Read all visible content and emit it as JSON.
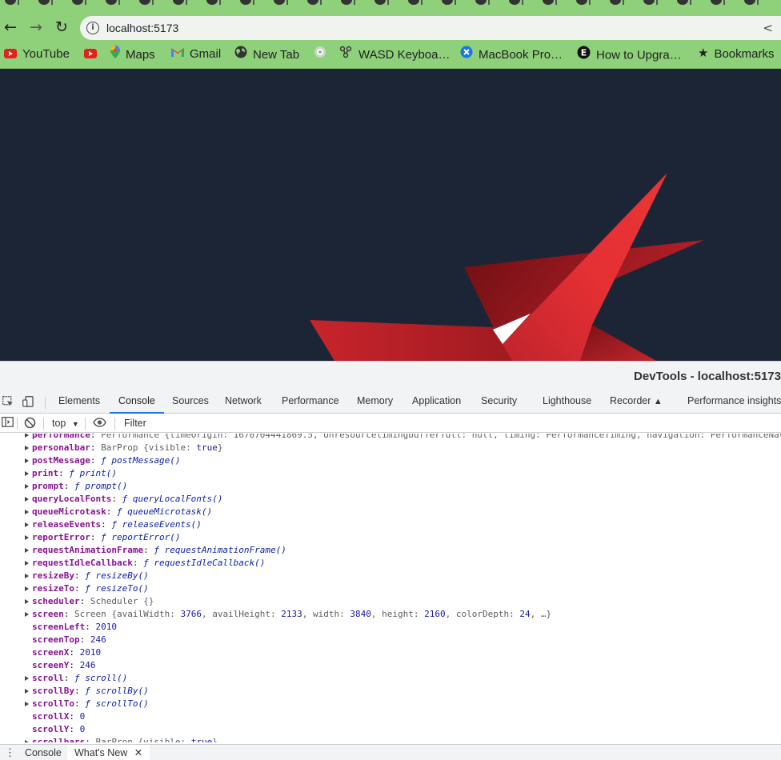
{
  "browser": {
    "url": "localhost:5173",
    "bookmarks": [
      {
        "label": "YouTube",
        "icon": "youtube-icon"
      },
      {
        "label": "",
        "icon": "youtube-icon"
      },
      {
        "label": "Maps",
        "icon": "maps-pin-icon"
      },
      {
        "label": "Gmail",
        "icon": "gmail-icon"
      },
      {
        "label": "New Tab",
        "icon": "globe-icon"
      },
      {
        "label": "",
        "icon": "app-icon"
      },
      {
        "label": "WASD Keyboa…",
        "icon": "keyboard-icon"
      },
      {
        "label": "MacBook Pro…",
        "icon": "x-circle-icon"
      },
      {
        "label": "How to Upgra…",
        "icon": "e-circle-icon"
      },
      {
        "label": "Bookmarks",
        "icon": "star-icon"
      }
    ],
    "colors": {
      "chrome": "#8fd07a",
      "page_bg": "#1c2536",
      "shape_red": "#e03030",
      "shape_dark_red": "#8b1a1a"
    }
  },
  "devtools": {
    "title": "DevTools - localhost:5173",
    "tabs": [
      "Elements",
      "Console",
      "Sources",
      "Network",
      "Performance",
      "Memory",
      "Application",
      "Security",
      "Lighthouse",
      "Recorder",
      "Performance insights"
    ],
    "active_tab": "Console",
    "context": "top",
    "filter_placeholder": "Filter",
    "drawer_tabs": [
      "Console",
      "What's New"
    ],
    "console_rows": [
      {
        "expand": true,
        "key": "performance",
        "sep": ": ",
        "parts": [
          [
            "g",
            "Performance {timeOrigin: 1670704441869.5, onresourcetimingbufferfull: null, timing: PerformanceTiming, navigation: PerformanceNav"
          ]
        ]
      },
      {
        "expand": true,
        "key": "personalbar",
        "sep": ": ",
        "parts": [
          [
            "g",
            "BarProp {visible: "
          ],
          [
            "n",
            "true"
          ],
          [
            "g",
            "}"
          ]
        ]
      },
      {
        "expand": true,
        "key": "postMessage",
        "sep": ": ",
        "parts": [
          [
            "f",
            "ƒ postMessage()"
          ]
        ]
      },
      {
        "expand": true,
        "key": "print",
        "sep": ": ",
        "parts": [
          [
            "f",
            "ƒ print()"
          ]
        ]
      },
      {
        "expand": true,
        "key": "prompt",
        "sep": ": ",
        "parts": [
          [
            "f",
            "ƒ prompt()"
          ]
        ]
      },
      {
        "expand": true,
        "key": "queryLocalFonts",
        "sep": ": ",
        "parts": [
          [
            "f",
            "ƒ queryLocalFonts()"
          ]
        ]
      },
      {
        "expand": true,
        "key": "queueMicrotask",
        "sep": ": ",
        "parts": [
          [
            "f",
            "ƒ queueMicrotask()"
          ]
        ]
      },
      {
        "expand": true,
        "key": "releaseEvents",
        "sep": ": ",
        "parts": [
          [
            "f",
            "ƒ releaseEvents()"
          ]
        ]
      },
      {
        "expand": true,
        "key": "reportError",
        "sep": ": ",
        "parts": [
          [
            "f",
            "ƒ reportError()"
          ]
        ]
      },
      {
        "expand": true,
        "key": "requestAnimationFrame",
        "sep": ": ",
        "parts": [
          [
            "f",
            "ƒ requestAnimationFrame()"
          ]
        ]
      },
      {
        "expand": true,
        "key": "requestIdleCallback",
        "sep": ": ",
        "parts": [
          [
            "f",
            "ƒ requestIdleCallback()"
          ]
        ]
      },
      {
        "expand": true,
        "key": "resizeBy",
        "sep": ": ",
        "parts": [
          [
            "f",
            "ƒ resizeBy()"
          ]
        ]
      },
      {
        "expand": true,
        "key": "resizeTo",
        "sep": ": ",
        "parts": [
          [
            "f",
            "ƒ resizeTo()"
          ]
        ]
      },
      {
        "expand": true,
        "key": "scheduler",
        "sep": ": ",
        "parts": [
          [
            "g",
            "Scheduler {}"
          ]
        ]
      },
      {
        "expand": true,
        "key": "screen",
        "sep": ": ",
        "parts": [
          [
            "g",
            "Screen {availWidth: "
          ],
          [
            "n",
            "3766"
          ],
          [
            "g",
            ", availHeight: "
          ],
          [
            "n",
            "2133"
          ],
          [
            "g",
            ", width: "
          ],
          [
            "n",
            "3840"
          ],
          [
            "g",
            ", height: "
          ],
          [
            "n",
            "2160"
          ],
          [
            "g",
            ", colorDepth: "
          ],
          [
            "n",
            "24"
          ],
          [
            "g",
            ", …}"
          ]
        ]
      },
      {
        "expand": false,
        "key": "screenLeft",
        "sep": ": ",
        "parts": [
          [
            "n",
            "2010"
          ]
        ]
      },
      {
        "expand": false,
        "key": "screenTop",
        "sep": ": ",
        "parts": [
          [
            "n",
            "246"
          ]
        ]
      },
      {
        "expand": false,
        "key": "screenX",
        "sep": ": ",
        "parts": [
          [
            "n",
            "2010"
          ]
        ]
      },
      {
        "expand": false,
        "key": "screenY",
        "sep": ": ",
        "parts": [
          [
            "n",
            "246"
          ]
        ]
      },
      {
        "expand": true,
        "key": "scroll",
        "sep": ": ",
        "parts": [
          [
            "f",
            "ƒ scroll()"
          ]
        ]
      },
      {
        "expand": true,
        "key": "scrollBy",
        "sep": ": ",
        "parts": [
          [
            "f",
            "ƒ scrollBy()"
          ]
        ]
      },
      {
        "expand": true,
        "key": "scrollTo",
        "sep": ": ",
        "parts": [
          [
            "f",
            "ƒ scrollTo()"
          ]
        ]
      },
      {
        "expand": false,
        "key": "scrollX",
        "sep": ": ",
        "parts": [
          [
            "n",
            "0"
          ]
        ]
      },
      {
        "expand": false,
        "key": "scrollY",
        "sep": ": ",
        "parts": [
          [
            "n",
            "0"
          ]
        ]
      },
      {
        "expand": true,
        "key": "scrollbars",
        "sep": ": ",
        "parts": [
          [
            "g",
            "BarProp {visible: "
          ],
          [
            "n",
            "true"
          ],
          [
            "g",
            "}"
          ]
        ]
      }
    ]
  }
}
